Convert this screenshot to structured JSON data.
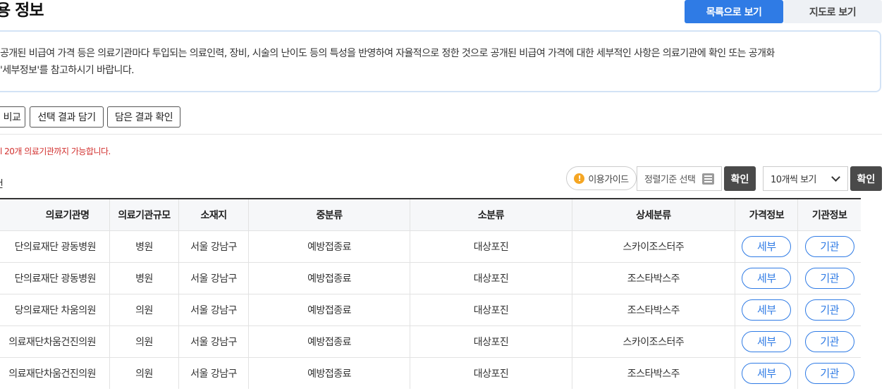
{
  "header": {
    "title": "용 정보",
    "view_list_label": "목록으로 보기",
    "view_map_label": "지도로 보기"
  },
  "notice": {
    "line1": " 공개된 비급여 가격 등은 의료기관마다 투입되는 의료인력, 장비, 시술의 난이도 등의 특성을 반영하여 자율적으로 정한 것으로 공개된 비급여 가격에 대한 세부적인 사항은 의료기관에 확인 또는 공개화",
    "line2": "'세부정보'를 참고하시기 바랍니다."
  },
  "toolbar": {
    "compare_label": "비교",
    "save_selected_label": "선택 결과 담기",
    "check_saved_label": "담은 결과 확인"
  },
  "warning_text": "l 20개 의료기관까지 가능합니다.",
  "count_text": "건",
  "controls": {
    "guide_label": "이용가이드",
    "guide_icon": "!",
    "sort_placeholder": "정렬기준 선택",
    "sort_confirm_label": "확인",
    "per_page_value": "10개씩 보기",
    "per_page_confirm_label": "확인"
  },
  "table": {
    "headers": [
      "의료기관명",
      "의료기관규모",
      "소재지",
      "중분류",
      "소분류",
      "상세분류",
      "가격정보",
      "기관정보"
    ],
    "rows": [
      {
        "name": "단의료재단 광동병원",
        "size": "병원",
        "location": "서울 강남구",
        "mid": "예방접종료",
        "sub": "대상포진",
        "detail": "스카이조스터주",
        "price": "세부",
        "org": "기관"
      },
      {
        "name": "단의료재단 광동병원",
        "size": "병원",
        "location": "서울 강남구",
        "mid": "예방접종료",
        "sub": "대상포진",
        "detail": "조스타박스주",
        "price": "세부",
        "org": "기관"
      },
      {
        "name": "당의료재단 차움의원",
        "size": "의원",
        "location": "서울 강남구",
        "mid": "예방접종료",
        "sub": "대상포진",
        "detail": "조스타박스주",
        "price": "세부",
        "org": "기관"
      },
      {
        "name": "의료재단차움건진의원",
        "size": "의원",
        "location": "서울 강남구",
        "mid": "예방접종료",
        "sub": "대상포진",
        "detail": "스카이조스터주",
        "price": "세부",
        "org": "기관"
      },
      {
        "name": "의료재단차움건진의원",
        "size": "의원",
        "location": "서울 강남구",
        "mid": "예방접종료",
        "sub": "대상포진",
        "detail": "조스타박스주",
        "price": "세부",
        "org": "기관"
      }
    ]
  }
}
